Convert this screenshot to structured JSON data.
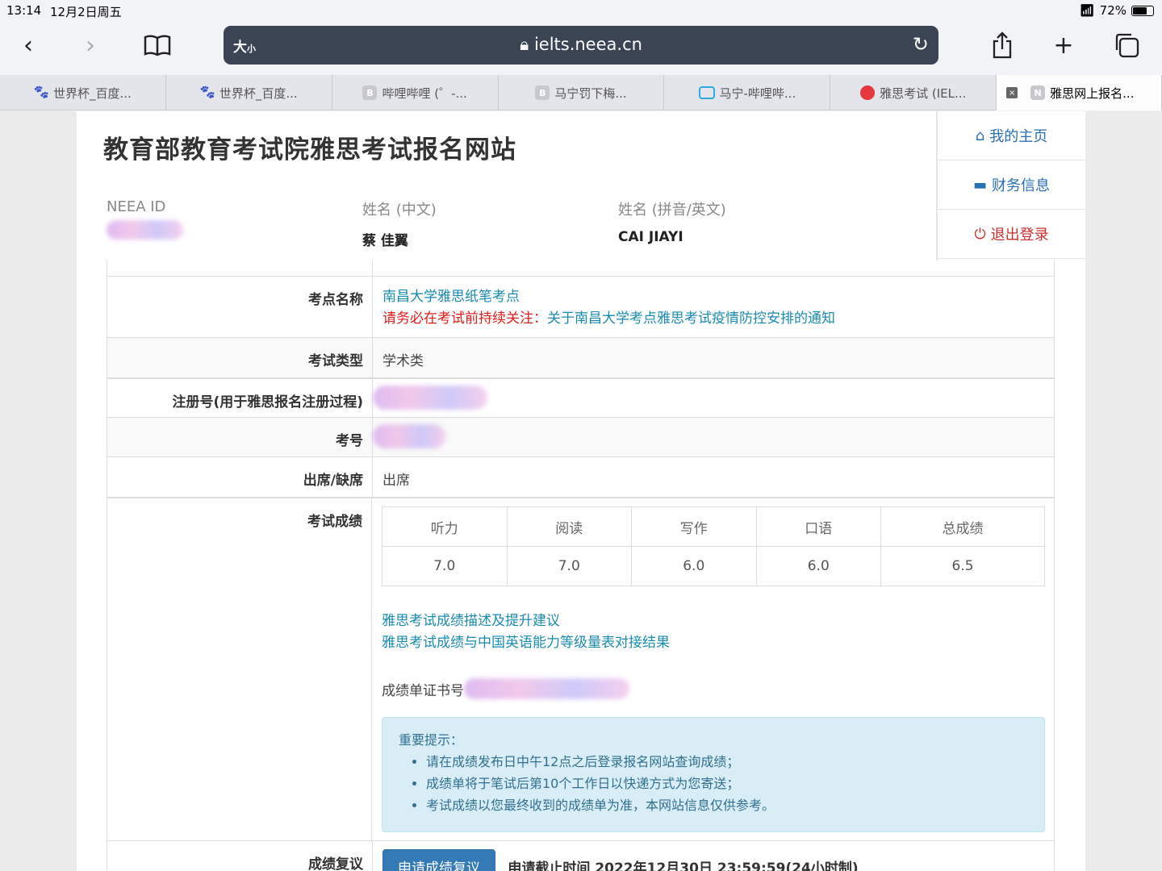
{
  "status": {
    "time": "13:14",
    "date": "12月2日周五",
    "battery": "72%",
    "battery_level": 0.72
  },
  "toolbar": {
    "text_size": "大",
    "text_size_small": "小",
    "url": "ielts.neea.cn"
  },
  "tabs": [
    {
      "label": "世界杯_百度...",
      "icon": "baidu-icon"
    },
    {
      "label": "世界杯_百度...",
      "icon": "baidu-icon"
    },
    {
      "label": "哔哩哔哩 (゜-...",
      "icon": "b-letter-icon",
      "fav": "B"
    },
    {
      "label": "马宁罚下梅...",
      "icon": "b-letter-icon",
      "fav": "B"
    },
    {
      "label": "马宁-哔哩哔...",
      "icon": "tv-icon"
    },
    {
      "label": "雅思考试 (IEL...",
      "icon": "ielts-icon"
    },
    {
      "label": "雅思网上报名...",
      "icon": "n-letter-icon",
      "fav": "N",
      "close": "×"
    }
  ],
  "header": {
    "title": "教育部教育考试院雅思考试报名网站",
    "neea_label": "NEEA ID",
    "name_cn_label": "姓名 (中文)",
    "name_cn": "蔡 佳翼",
    "name_en_label": "姓名 (拼音/英文)",
    "name_en": "CAI JIAYI"
  },
  "nav": {
    "home": "我的主页",
    "finance": "财务信息",
    "logout": "退出登录"
  },
  "rows": {
    "venue_label": "考点名称",
    "venue": "南昌大学雅思纸笔考点",
    "notice_prefix": "请务必在考试前持续关注：",
    "notice_link": "关于南昌大学考点雅思考试疫情防控安排的通知",
    "type_label": "考试类型",
    "type": "学术类",
    "reg_label": "注册号(用于雅思报名注册过程)",
    "candidate_label": "考号",
    "attend_label": "出席/缺席",
    "attend": "出席",
    "score_label": "考试成绩",
    "review_label": "成绩复议"
  },
  "scores": {
    "headers": [
      "听力",
      "阅读",
      "写作",
      "口语",
      "总成绩"
    ],
    "values": [
      "7.0",
      "7.0",
      "6.0",
      "6.0",
      "6.5"
    ]
  },
  "links": {
    "desc": "雅思考试成绩描述及提升建议",
    "cse": "雅思考试成绩与中国英语能力等级量表对接结果"
  },
  "trf_label": "成绩单证书号",
  "alert": {
    "title": "重要提示：",
    "items": [
      "请在成绩发布日中午12点之后登录报名网站查询成绩；",
      "成绩单将于笔试后第10个工作日以快递方式为您寄送；",
      "考试成绩以您最终收到的成绩单为准，本网站信息仅供参考。"
    ]
  },
  "review": {
    "button": "申请成绩复议",
    "deadline": "申请截止时间 2022年12月30日 23:59:59(24小时制)"
  }
}
